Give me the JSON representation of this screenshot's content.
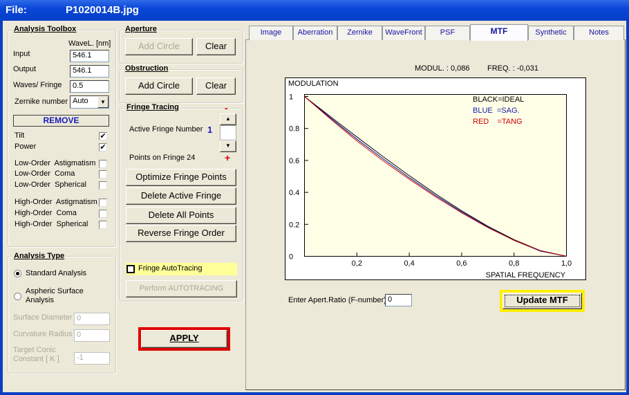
{
  "title": {
    "label": "File:",
    "filename": "P1020014B.jpg"
  },
  "toolbox": {
    "legend": "Analysis Toolbox",
    "wavel_header": "WaveL. [nm]",
    "input_label": "Input",
    "input_value": "546.1",
    "output_label": "Output",
    "output_value": "546.1",
    "waves_label": "Waves/ Fringe",
    "waves_value": "0.5",
    "zernike_label": "Zernike number",
    "zernike_value": "Auto",
    "remove_label": "REMOVE",
    "items": [
      {
        "label": "Tilt",
        "checked": true
      },
      {
        "label": "Power",
        "checked": true
      },
      {
        "label": "Low-Order  Astigmatism",
        "checked": false
      },
      {
        "label": "Low-Order  Coma",
        "checked": false
      },
      {
        "label": "Low-Order  Spherical",
        "checked": false
      },
      {
        "label": "High-Order  Astigmatism",
        "checked": false
      },
      {
        "label": "High-Order  Coma",
        "checked": false
      },
      {
        "label": "High-Order  Spherical",
        "checked": false
      }
    ]
  },
  "aperture": {
    "legend": "Aperture",
    "add": "Add Circle",
    "clear": "Clear"
  },
  "obstruction": {
    "legend": "Obstruction",
    "add": "Add Circle",
    "clear": "Clear"
  },
  "fringe": {
    "legend": "Fringe Tracing",
    "minus": "-",
    "plus": "+",
    "active_label": "Active Fringe Number",
    "active_value": "1",
    "points_label": "Points on  Fringe 24",
    "optimize": "Optimize Fringe Points",
    "delete_active": "Delete Active Fringe",
    "delete_all": "Delete  All  Points",
    "reverse": "Reverse  Fringe Order",
    "autotracing_label": "Fringe AutoTracing",
    "perform": "Perform  AUTOTRACING"
  },
  "analysis_type": {
    "legend": "Analysis Type",
    "standard": "Standard  Analysis",
    "aspheric": "Aspheric  Surface Analysis",
    "surface_diameter_label": "Surface Diameter",
    "surface_diameter_value": "0",
    "curvature_label": "Curvature Radius",
    "curvature_value": "0",
    "conic_label": "Target Conic Constant [ K ]",
    "conic_value": "-1"
  },
  "apply": "APPLY",
  "tabs": [
    "Image",
    "Aberration",
    "Zernike",
    "WaveFront",
    "PSF",
    "MTF",
    "Synthetic",
    "Notes"
  ],
  "active_tab": "MTF",
  "readout": {
    "modul": "MODUL. :  0,086",
    "freq": "FREQ. :  -0,031"
  },
  "apert": {
    "label": "Enter Apert.Ratio (F-number)",
    "value": "0"
  },
  "update_button": "Update MTF",
  "chart_data": {
    "type": "line",
    "ylabel": "MODULATION",
    "xlabel": "SPATIAL FREQUENCY",
    "xlim": [
      0,
      1
    ],
    "ylim": [
      0,
      1
    ],
    "xticks": [
      "0,2",
      "0,4",
      "0,6",
      "0,8",
      "1,0"
    ],
    "yticks": [
      "0",
      "0.2",
      "0.4",
      "0.6",
      "0.8",
      "1"
    ],
    "legend": [
      "BLACK=IDEAL",
      "BLUE  =SAG.",
      "RED    =TANG"
    ],
    "background": "#ffffe8",
    "x": [
      0,
      0.1,
      0.2,
      0.3,
      0.4,
      0.5,
      0.6,
      0.7,
      0.8,
      0.9,
      1.0
    ],
    "series": [
      {
        "name": "IDEAL",
        "color": "#000000",
        "values": [
          1,
          0.873,
          0.747,
          0.624,
          0.505,
          0.391,
          0.285,
          0.188,
          0.104,
          0.036,
          0
        ]
      },
      {
        "name": "SAG.",
        "color": "#00008b",
        "values": [
          1,
          0.865,
          0.733,
          0.61,
          0.492,
          0.381,
          0.278,
          0.183,
          0.1,
          0.033,
          0
        ]
      },
      {
        "name": "TANG",
        "color": "#cc0000",
        "values": [
          1,
          0.858,
          0.722,
          0.598,
          0.482,
          0.373,
          0.272,
          0.18,
          0.1,
          0.036,
          0
        ]
      }
    ]
  }
}
